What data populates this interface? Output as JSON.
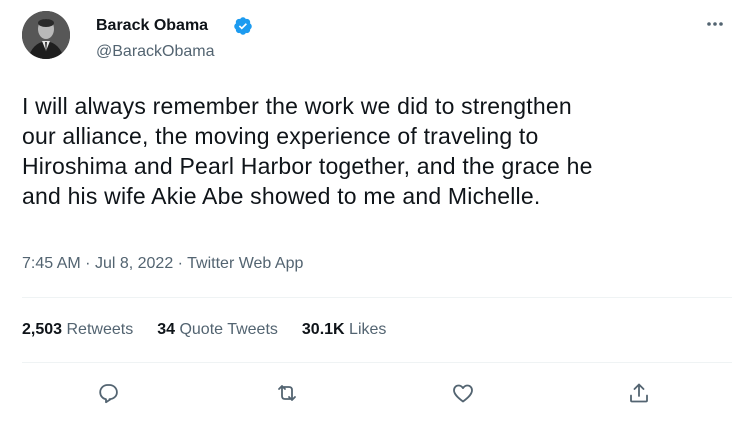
{
  "author": {
    "display_name": "Barack Obama",
    "handle": "@BarackObama",
    "verified_icon": "verified-badge-icon",
    "verified_color": "#1d9bf0"
  },
  "tweet": {
    "lines": [
      "I will always remember the work we did to strengthen",
      "our alliance, the moving experience of traveling to",
      "Hiroshima and Pearl Harbor together, and the grace he",
      "and his wife Akie Abe showed to me and Michelle."
    ]
  },
  "meta": {
    "time": "7:45 AM",
    "separator": "·",
    "date": "Jul 8, 2022",
    "source": "Twitter Web App"
  },
  "stats": {
    "retweets_count": "2,503",
    "retweets_label": "Retweets",
    "quotes_count": "34",
    "quotes_label": "Quote Tweets",
    "likes_count": "30.1K",
    "likes_label": "Likes"
  },
  "actions": [
    "reply-icon",
    "retweet-icon",
    "like-icon",
    "share-icon"
  ],
  "colors": {
    "text": "#0f1419",
    "secondary": "#536471",
    "divider": "#eff3f4"
  }
}
